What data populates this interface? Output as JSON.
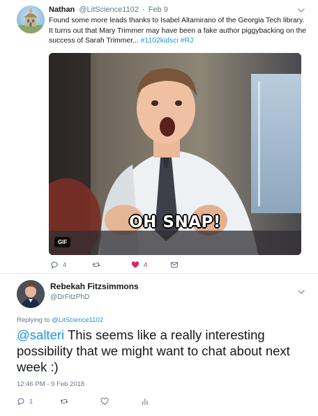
{
  "tweet1": {
    "author_name": "Nathan",
    "author_handle": "@LitScience1102",
    "separator": "·",
    "date": "Feb 9",
    "text_lines": [
      "Found some more leads thanks to Isabel Altamirano of the Georgia Tech library.",
      "It turns out that Mary Trimmer may have been a fake author piggybacking on the",
      "success of Sarah Trimmer..."
    ],
    "hashtags": "#1102kidsci #RJ",
    "media": {
      "overlay_text": "OH SNAP!",
      "badge": "GIF"
    },
    "actions": {
      "reply_count": "4",
      "retweet_count": "",
      "like_count": "4"
    }
  },
  "tweet2": {
    "author_name": "Rebekah Fitzsimmons",
    "author_handle": "@DrFitzPhD",
    "replying_prefix": "Replying to",
    "replying_handle": "@LitScience1102",
    "mention": "@salteri",
    "text": " This seems like a really interesting possibility that we might want to chat about next week :)",
    "timestamp": "12:46 PM - 9 Feb 2018",
    "actions": {
      "reply_count": "1",
      "retweet_count": "",
      "like_count": ""
    }
  },
  "colors": {
    "link": "#1b95e0",
    "like_active": "#e0245e",
    "secondary_text": "#657786"
  }
}
